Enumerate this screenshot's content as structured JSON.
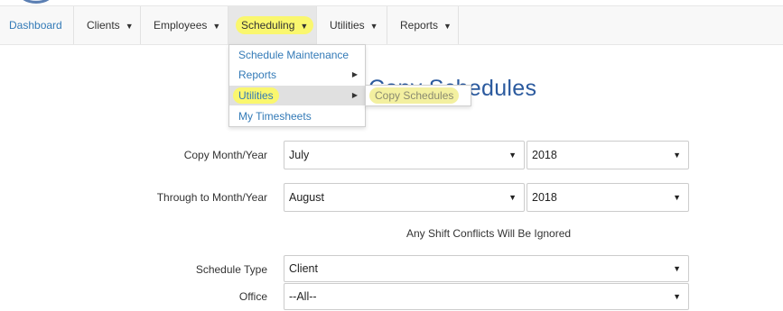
{
  "navbar": {
    "brand": "Dashboard",
    "items": [
      {
        "label": "Clients",
        "caret": "▼"
      },
      {
        "label": "Employees",
        "caret": "▼"
      },
      {
        "label": "Scheduling",
        "caret": "▼"
      },
      {
        "label": "Utilities",
        "caret": "▼"
      },
      {
        "label": "Reports",
        "caret": "▼"
      }
    ]
  },
  "scheduling_menu": {
    "items": [
      {
        "label": "Schedule Maintenance",
        "arrow": ""
      },
      {
        "label": "Reports",
        "arrow": "▶"
      },
      {
        "label": "Utilities",
        "arrow": "▶"
      },
      {
        "label": "My Timesheets",
        "arrow": ""
      }
    ]
  },
  "utilities_submenu": {
    "items": [
      {
        "label": "Copy Schedules"
      }
    ]
  },
  "page": {
    "title": "Copy Schedules"
  },
  "form": {
    "copy_month_year": {
      "label": "Copy Month/Year",
      "month": "July",
      "year": "2018"
    },
    "through_month_year": {
      "label": "Through to Month/Year",
      "month": "August",
      "year": "2018"
    },
    "conflict_note": "Any Shift Conflicts Will Be Ignored",
    "schedule_type": {
      "label": "Schedule Type",
      "value": "Client"
    },
    "office": {
      "label": "Office",
      "value": "--All--"
    },
    "select_arrow": "▼"
  },
  "colors": {
    "highlight": "#faf76e",
    "link": "#337ab7",
    "title": "#2b5a9e"
  }
}
